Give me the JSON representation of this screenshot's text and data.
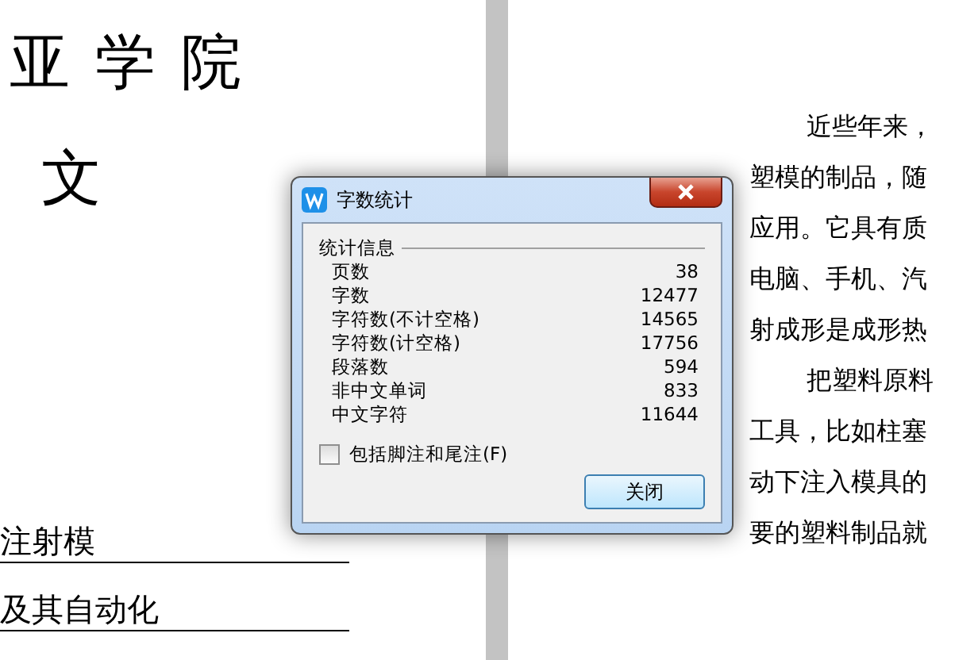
{
  "left_page": {
    "title": "亚 学 院",
    "subtitle": "文",
    "fields": [
      "注射模",
      "及其自动化"
    ]
  },
  "right_page": {
    "paragraphs": [
      {
        "lines": [
          "近些年来，",
          "塑模的制品，随",
          "应用。它具有质",
          "电脑、手机、汽",
          "射成形是成形热"
        ]
      },
      {
        "lines": [
          "把塑料原料",
          "工具，比如柱塞",
          "动下注入模具的",
          "要的塑料制品就"
        ]
      }
    ]
  },
  "dialog": {
    "title": "字数统计",
    "group_label": "统计信息",
    "stats": [
      {
        "label": "页数",
        "value": "38"
      },
      {
        "label": "字数",
        "value": "12477"
      },
      {
        "label": "字符数(不计空格)",
        "value": "14565"
      },
      {
        "label": "字符数(计空格)",
        "value": "17756"
      },
      {
        "label": "段落数",
        "value": "594"
      },
      {
        "label": "非中文单词",
        "value": "833"
      },
      {
        "label": "中文字符",
        "value": "11644"
      }
    ],
    "checkbox": {
      "label": "包括脚注和尾注(F)",
      "checked": false
    },
    "button": "关闭"
  }
}
